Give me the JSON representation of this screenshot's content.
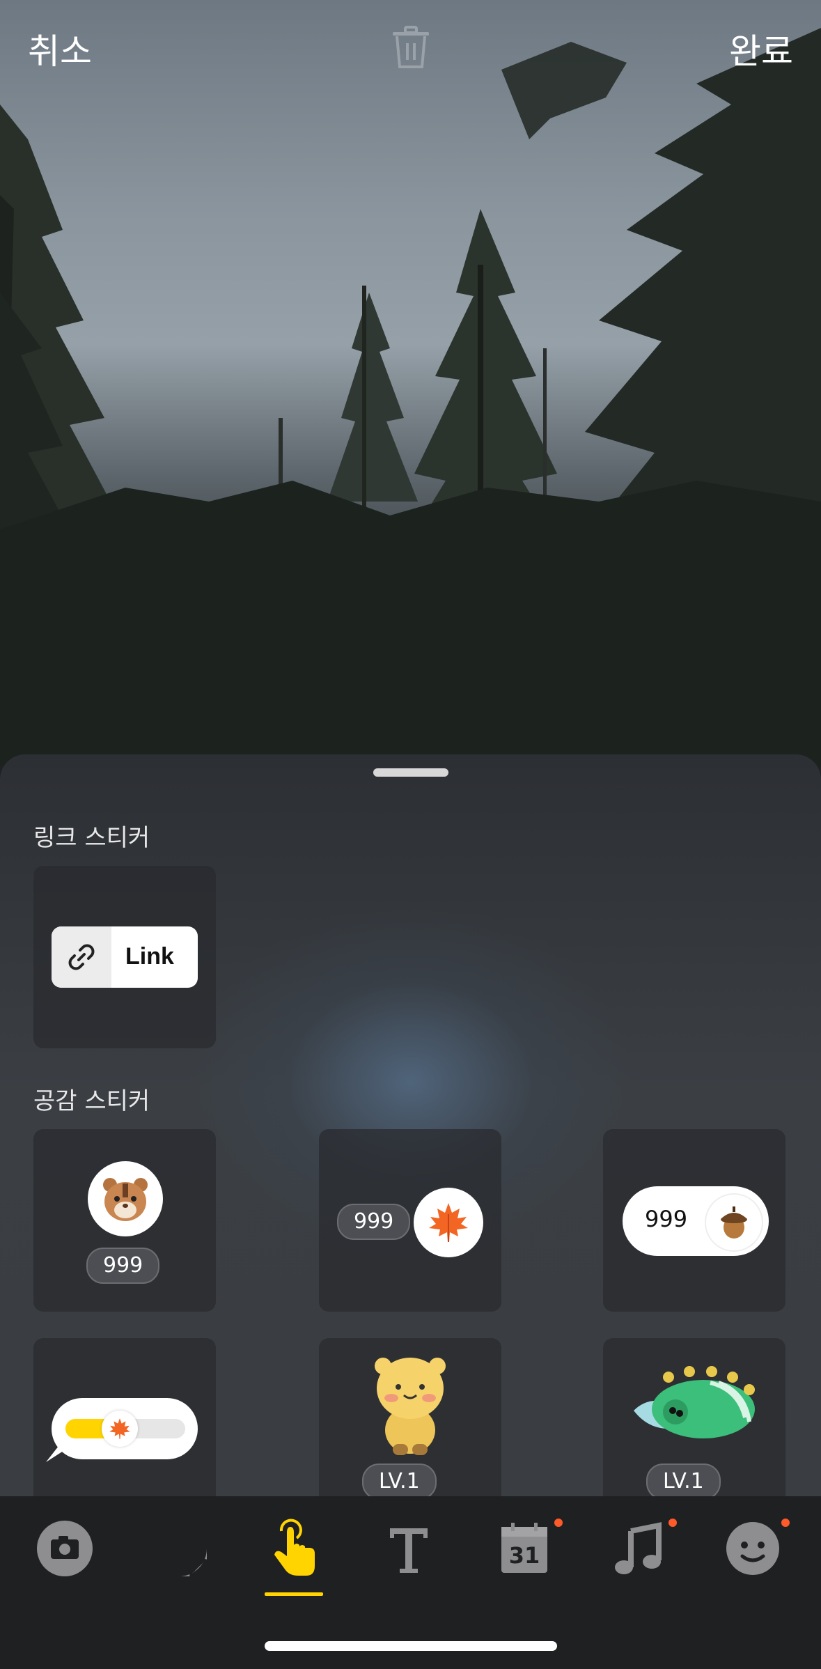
{
  "topbar": {
    "cancel_label": "취소",
    "done_label": "완료",
    "trash_icon": "trash-icon"
  },
  "sheet": {
    "link_section_title": "링크 스티커",
    "link_sticker_label": "Link",
    "empathy_section_title": "공감 스티커",
    "stickers": [
      {
        "icon": "chipmunk-face-sticker",
        "count": "999"
      },
      {
        "icon": "maple-leaf-sticker",
        "count": "999"
      },
      {
        "icon": "acorn-sticker",
        "count": "999"
      },
      {
        "icon": "maple-leaf-slider-sticker"
      },
      {
        "icon": "bear-character-sticker",
        "level": "LV.1"
      },
      {
        "icon": "dinosaur-character-sticker",
        "level": "LV.1"
      }
    ]
  },
  "tabbar": {
    "tabs": [
      {
        "name": "camera-icon",
        "active": false,
        "badge": false
      },
      {
        "name": "star-sticker-icon",
        "active": false,
        "badge": false
      },
      {
        "name": "tap-hand-icon",
        "active": true,
        "badge": false
      },
      {
        "name": "text-icon",
        "active": false,
        "badge": false
      },
      {
        "name": "calendar-icon",
        "label": "31",
        "active": false,
        "badge": true
      },
      {
        "name": "music-icon",
        "active": false,
        "badge": true
      },
      {
        "name": "emoji-icon",
        "active": false,
        "badge": true
      }
    ],
    "active_color": "#ffd400",
    "badge_color": "#ff5a2a"
  }
}
